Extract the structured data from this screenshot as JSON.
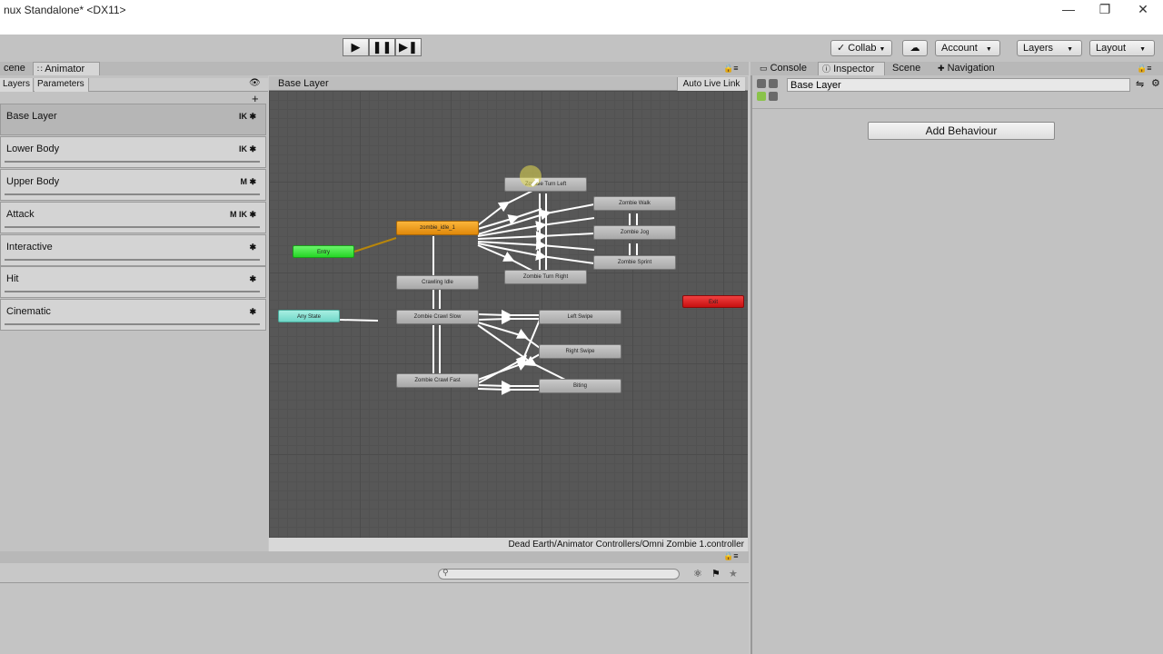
{
  "window": {
    "title": "nux Standalone* <DX11>"
  },
  "toolbar": {
    "collab": "Collab",
    "account": "Account",
    "layers": "Layers",
    "layout": "Layout"
  },
  "animator": {
    "tab_scene": "cene",
    "tab_animator": "Animator",
    "subtab_layers": "Layers",
    "subtab_parameters": "Parameters",
    "add": "+",
    "layers": [
      {
        "name": "Base Layer",
        "flags": "IK ✱"
      },
      {
        "name": "Lower Body",
        "flags": "IK ✱"
      },
      {
        "name": "Upper Body",
        "flags": "M ✱"
      },
      {
        "name": "Attack",
        "flags": "M IK ✱"
      },
      {
        "name": "Interactive",
        "flags": "✱"
      },
      {
        "name": "Hit",
        "flags": "✱"
      },
      {
        "name": "Cinematic",
        "flags": "✱"
      }
    ],
    "breadcrumb": "Base Layer",
    "auto_live_link": "Auto Live Link",
    "path": "Dead Earth/Animator Controllers/Omni Zombie 1.controller",
    "nodes": {
      "entry": "Entry",
      "any_state": "Any State",
      "exit": "Exit",
      "idle": "zombie_idle_1",
      "turn_left": "Zombie Turn Left",
      "turn_right": "Zombie Turn Right",
      "walk": "Zombie Walk",
      "jog": "Zombie Jog",
      "sprint": "Zombie Sprint",
      "crawling_idle": "Crawling Idle",
      "crawl_slow": "Zombie Crawl Slow",
      "crawl_fast": "Zombie Crawl Fast",
      "left_swipe": "Left Swipe",
      "right_swipe": "Right Swipe",
      "biting": "Biting"
    }
  },
  "inspector": {
    "tabs": [
      "Console",
      "Inspector",
      "Scene",
      "Navigation"
    ],
    "name_value": "Base Layer",
    "add_behaviour": "Add Behaviour"
  },
  "colors": {
    "entry": "#2ee62e",
    "any_state": "#7fe0d0",
    "exit": "#dd1a1a",
    "default_state": "#f59a10"
  }
}
